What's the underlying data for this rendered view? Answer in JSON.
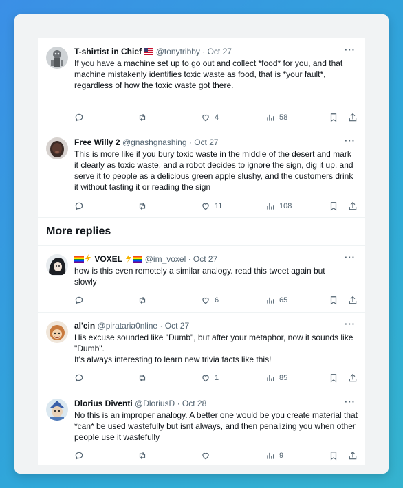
{
  "colors": {
    "background_gradient": [
      "#3b8fe6",
      "#35b3cf"
    ],
    "text": "#0f1419",
    "muted": "#536471"
  },
  "section_title": "More replies",
  "tweets": [
    {
      "name": "T-shirtist in Chief",
      "name_suffix_icon": "us-flag-icon",
      "handle": "@tonytribby",
      "date": "Oct 27",
      "lines": [
        "If you have a machine set up to go out and collect *food* for you, and that machine mistakenly identifies toxic waste as food, that is *your fault*, regardless of how the toxic waste got there."
      ],
      "likes": "4",
      "views": "58",
      "avatar_icon": "robot-avatar-icon"
    },
    {
      "name": "Free Willy 2",
      "handle": "@gnashgnashing",
      "date": "Oct 27",
      "lines": [
        "This is more like if you bury toxic waste in the middle of the desert and mark it clearly as toxic waste, and a robot decides to ignore the sign, dig it up, and serve it to people as a delicious green apple slushy, and the customers drink it without tasting it or reading the sign"
      ],
      "likes": "11",
      "views": "108",
      "avatar_icon": "person-avatar-icon"
    },
    {
      "name": "VOXEL",
      "name_prefix_icons": [
        "rainbow-flag-icon",
        "lightning-icon"
      ],
      "name_suffix_icons": [
        "lightning-icon",
        "rainbow-flag-icon"
      ],
      "handle": "@im_voxel",
      "date": "Oct 27",
      "lines": [
        "how is this even remotely a similar analogy. read this tweet again but slowly"
      ],
      "likes": "6",
      "views": "65",
      "avatar_icon": "anime-avatar-icon"
    },
    {
      "name": "al'ein",
      "handle": "@pirataria0nline",
      "date": "Oct 27",
      "lines": [
        "His excuse sounded like \"Dumb\", but after your metaphor, now it sounds like \"Dumb\".",
        "It's always interesting to learn new trivia facts like this!"
      ],
      "likes": "1",
      "views": "85",
      "avatar_icon": "cartoon-avatar-icon"
    },
    {
      "name": "Dlorius Diventi",
      "handle": "@DloriusD",
      "date": "Oct 28",
      "lines": [
        "No this is an improper analogy. A better one would be you create material that *can* be used wastefully but isnt always, and then penalizing you when other people use it wastefully"
      ],
      "likes": "",
      "views": "9",
      "avatar_icon": "character-avatar-icon"
    }
  ]
}
